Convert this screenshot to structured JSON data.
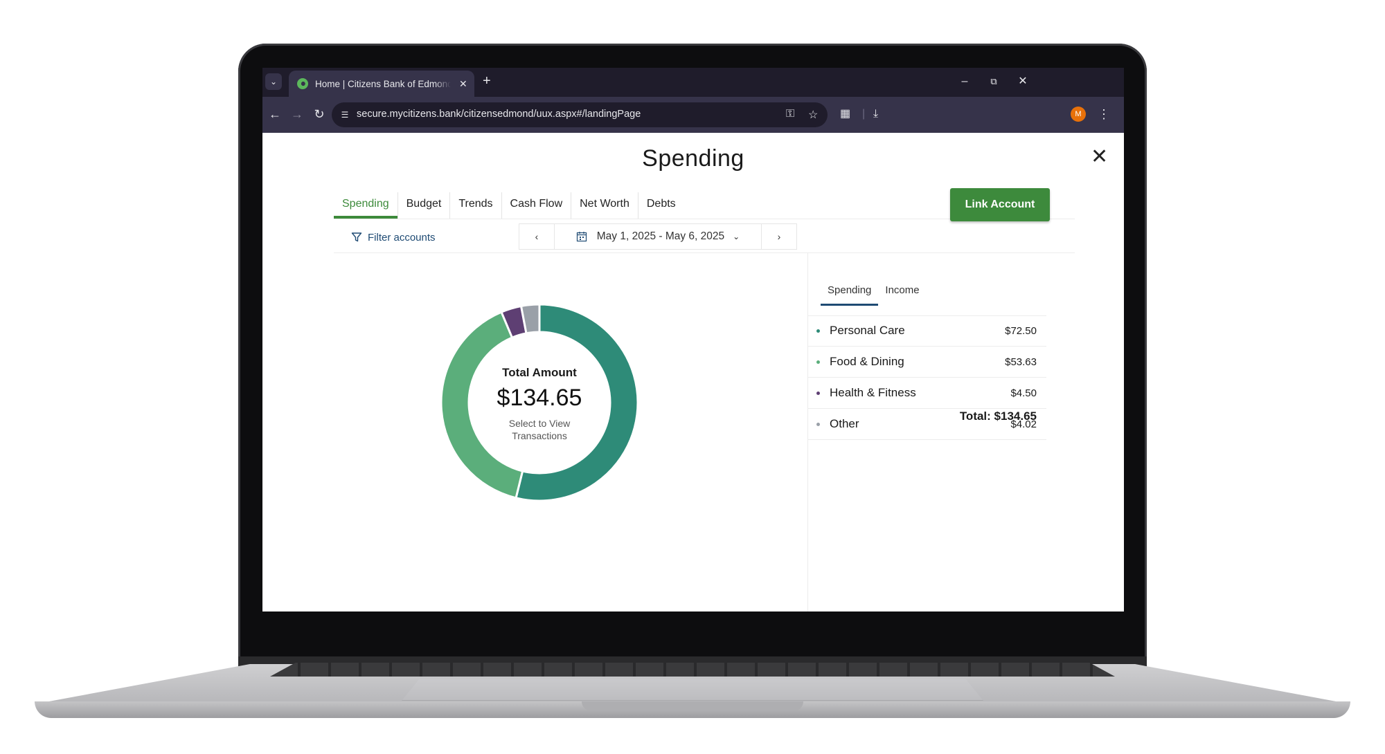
{
  "browser": {
    "tab_title": "Home | Citizens Bank of Edmond",
    "url": "secure.mycitizens.bank/citizensedmond/uux.aspx#/landingPage",
    "profile_initial": "M"
  },
  "modal": {
    "title": "Spending",
    "tabs": [
      "Spending",
      "Budget",
      "Trends",
      "Cash Flow",
      "Net Worth",
      "Debts"
    ],
    "active_tab": "Spending",
    "link_account_label": "Link Account",
    "filter_label": "Filter accounts",
    "date_range": "May 1, 2025 - May 6, 2025"
  },
  "summary": {
    "title": "Total Amount",
    "amount": "$134.65",
    "hint": "Select to View Transactions"
  },
  "right_panel": {
    "tabs": [
      "Spending",
      "Income"
    ],
    "active_tab": "Spending",
    "categories": [
      {
        "name": "Personal Care",
        "amount": "$72.50",
        "value": 72.5,
        "color": "#2e8b78"
      },
      {
        "name": "Food & Dining",
        "amount": "$53.63",
        "value": 53.63,
        "color": "#5bae7b"
      },
      {
        "name": "Health & Fitness",
        "amount": "$4.50",
        "value": 4.5,
        "color": "#5e3f73"
      },
      {
        "name": "Other",
        "amount": "$4.02",
        "value": 4.02,
        "color": "#9aa0a8"
      }
    ],
    "total_label": "Total: $134.65"
  },
  "chart_data": {
    "type": "pie",
    "categories": [
      "Personal Care",
      "Food & Dining",
      "Health & Fitness",
      "Other"
    ],
    "values": [
      72.5,
      53.63,
      4.5,
      4.02
    ]
  }
}
